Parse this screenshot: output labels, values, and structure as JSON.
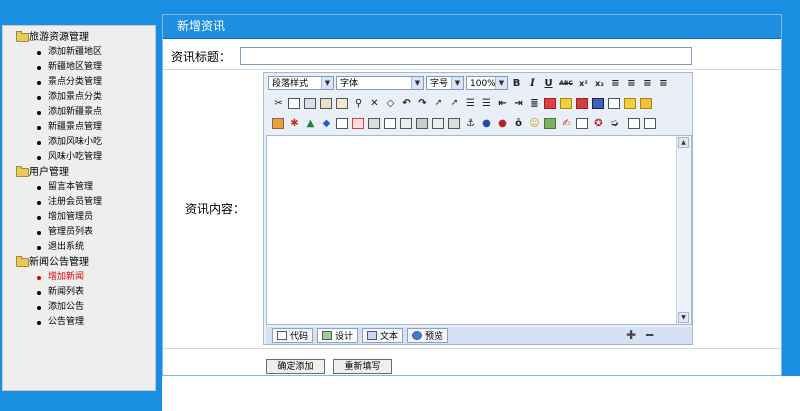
{
  "sidebar": {
    "sections": [
      {
        "title": "旅游资源管理",
        "items": [
          "添加新疆地区",
          "新疆地区管理",
          "景点分类管理",
          "添加景点分类",
          "添加新疆景点",
          "新疆景点管理",
          "添加风味小吃",
          "风味小吃管理"
        ]
      },
      {
        "title": "用户管理",
        "items": [
          "留言本管理",
          "注册会员管理",
          "增加管理员",
          "管理员列表",
          "退出系统"
        ]
      },
      {
        "title": "新闻公告管理",
        "items": [
          "增加新闻",
          "新闻列表",
          "添加公告",
          "公告管理"
        ]
      }
    ],
    "active_item": "增加新闻"
  },
  "main": {
    "heading": "新增资讯",
    "title_label": "资讯标题：",
    "title_value": "",
    "content_label": "资讯内容：",
    "editor": {
      "paragraph_style": "段落样式",
      "font": "字体",
      "font_size": "字号",
      "zoom": "100%",
      "bold": "B",
      "italic": "I",
      "underline": "U",
      "strike": "ABC",
      "superscript": "x²",
      "subscript": "x₂",
      "modes": [
        "代码",
        "设计",
        "文本",
        "预览"
      ]
    },
    "submit_label": "确定添加",
    "reset_label": "重新填写"
  }
}
